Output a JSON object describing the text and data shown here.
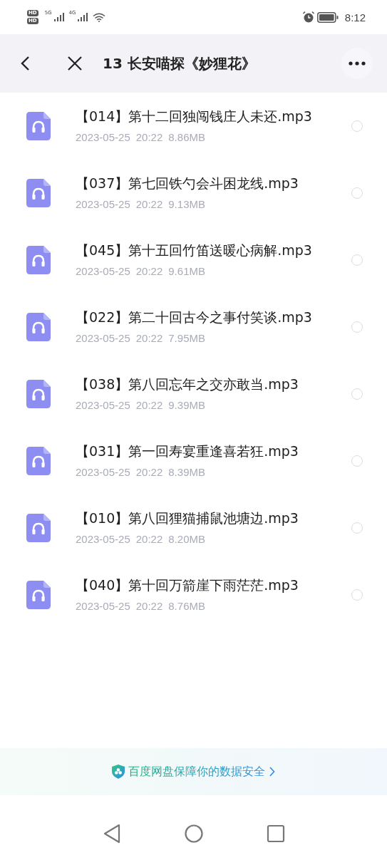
{
  "status_bar": {
    "sim_labels": [
      "HD",
      "HD"
    ],
    "networks": [
      "5G",
      "4G"
    ],
    "time": "8:12"
  },
  "header": {
    "title": "13 长安喵探《妙狸花》"
  },
  "files": [
    {
      "name": "【014】第十二回独闯钱庄人未还.mp3",
      "date": "2023-05-25",
      "time": "20:22",
      "size": "8.86MB",
      "selected": false
    },
    {
      "name": "【037】第七回铁勺会斗困龙线.mp3",
      "date": "2023-05-25",
      "time": "20:22",
      "size": "9.13MB",
      "selected": false
    },
    {
      "name": "【045】第十五回竹笛送暖心病解.mp3",
      "date": "2023-05-25",
      "time": "20:22",
      "size": "9.61MB",
      "selected": false
    },
    {
      "name": "【022】第二十回古今之事付笑谈.mp3",
      "date": "2023-05-25",
      "time": "20:22",
      "size": "7.95MB",
      "selected": false
    },
    {
      "name": "【038】第八回忘年之交亦敢当.mp3",
      "date": "2023-05-25",
      "time": "20:22",
      "size": "9.39MB",
      "selected": false
    },
    {
      "name": "【031】第一回寿宴重逢喜若狂.mp3",
      "date": "2023-05-25",
      "time": "20:22",
      "size": "8.39MB",
      "selected": false
    },
    {
      "name": "【010】第八回狸猫捕鼠池塘边.mp3",
      "date": "2023-05-25",
      "time": "20:22",
      "size": "8.20MB",
      "selected": false
    },
    {
      "name": "【040】第十回万箭崖下雨茫茫.mp3",
      "date": "2023-05-25",
      "time": "20:22",
      "size": "8.76MB",
      "selected": false
    }
  ],
  "footer": {
    "text": "百度网盘保障你的数据安全"
  }
}
